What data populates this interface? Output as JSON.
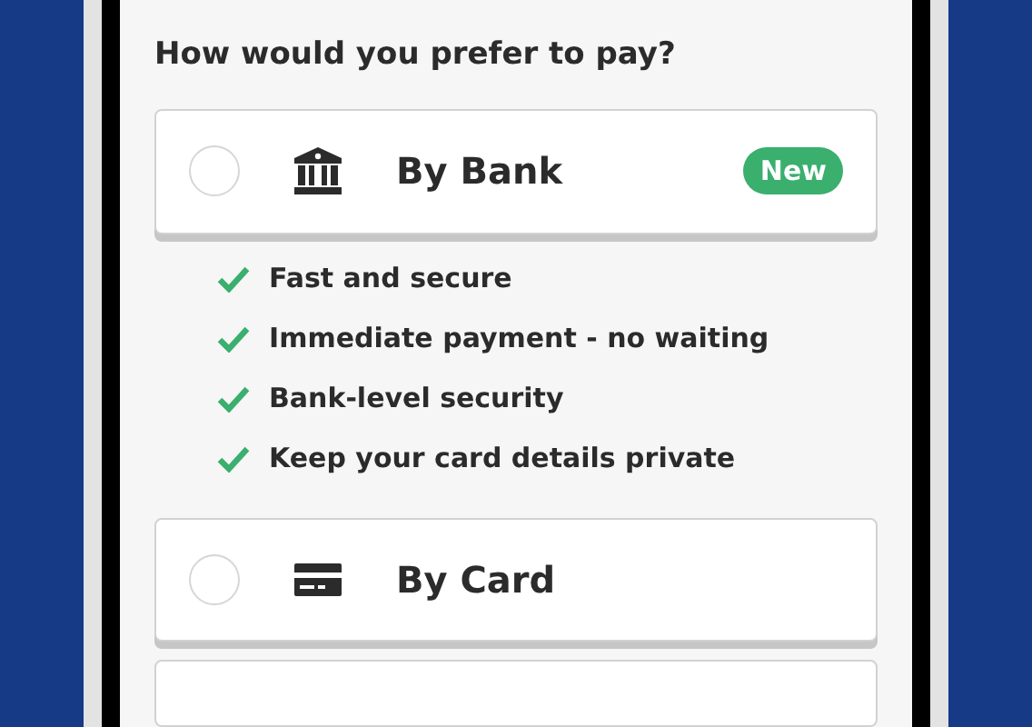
{
  "heading": "How would you prefer to pay?",
  "options": [
    {
      "label": "By Bank",
      "kind": "bank",
      "selected": false,
      "badge": "New",
      "features": [
        "Fast and secure",
        "Immediate payment - no waiting",
        "Bank-level security",
        "Keep your card details private"
      ]
    },
    {
      "label": "By Card",
      "kind": "card",
      "selected": false
    }
  ]
}
